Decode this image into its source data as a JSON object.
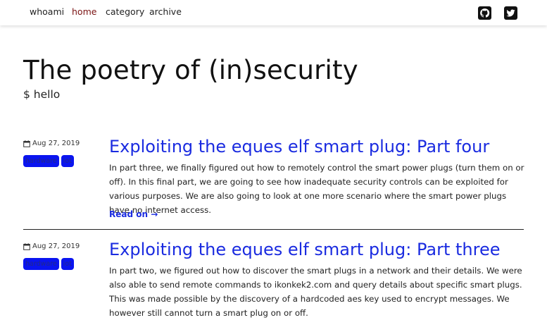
{
  "nav": {
    "items": [
      "whoami",
      "home",
      "category",
      "archive"
    ],
    "active": "home",
    "github_icon": "github-icon",
    "twitter_icon": "twitter-icon"
  },
  "header": {
    "title": "The poetry of (in)security",
    "subtitle": "$ hello"
  },
  "posts": [
    {
      "date": "Aug 27, 2019",
      "tags": [
        "hardware",
        "iot"
      ],
      "title": "Exploiting the eques elf smart plug: Part four",
      "excerpt": "In part three, we finally figured out how to remotely control the smart power plugs (turn them on or off). In this final part, we are going to see how inadequate security controls can be exploited for various purposes. We are also going to look at one more scenario where the smart power plugs have no internet access.",
      "read_on": "Read on →"
    },
    {
      "date": "Aug 27, 2019",
      "tags": [
        "hardware",
        "iot"
      ],
      "title": "Exploiting the eques elf smart plug: Part three",
      "excerpt": "In part two, we figured out how to discover the smart plugs in a network and their details. We were also able to send remote commands to ikonkek2.com and query details about specific smart plugs. This was made possible by the discovery of a hardcoded aes key used to encrypt messages. We however still cannot turn a smart plug on or off."
    }
  ],
  "colors": {
    "link": "#1a2be0",
    "active_nav": "#7a1212",
    "tag_bg": "#0a14f0"
  }
}
